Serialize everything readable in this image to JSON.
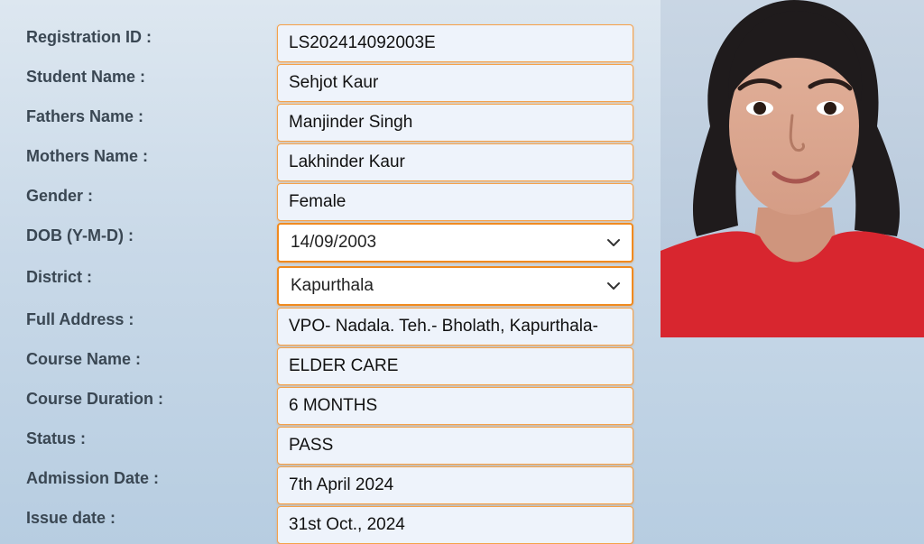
{
  "form": {
    "fields": [
      {
        "label": "Registration ID :",
        "value": "LS202414092003E"
      },
      {
        "label": "Student Name :",
        "value": "Sehjot Kaur"
      },
      {
        "label": "Fathers Name :",
        "value": "Manjinder Singh"
      },
      {
        "label": "Mothers Name :",
        "value": "Lakhinder Kaur"
      },
      {
        "label": "Gender :",
        "value": "Female"
      },
      {
        "label": "DOB (Y-M-D) :",
        "value": "14/09/2003"
      },
      {
        "label": "District :",
        "value": "Kapurthala"
      },
      {
        "label": "Full Address :",
        "value": "VPO- Nadala. Teh.- Bholath, Kapurthala-"
      },
      {
        "label": "Course Name :",
        "value": "ELDER CARE"
      },
      {
        "label": "Course Duration :",
        "value": "6 MONTHS"
      },
      {
        "label": "Status :",
        "value": "PASS"
      },
      {
        "label": "Admission Date :",
        "value": "7th April 2024"
      },
      {
        "label": "Issue date :",
        "value": "31st Oct., 2024"
      }
    ]
  },
  "icons": {
    "dropdown": "chevron-down-icon",
    "photo": "student-photo"
  },
  "colors": {
    "field_border": "#f5a14a",
    "select_border": "#f08a1f",
    "label_text": "#3a4753",
    "field_bg": "#eef3fb"
  }
}
